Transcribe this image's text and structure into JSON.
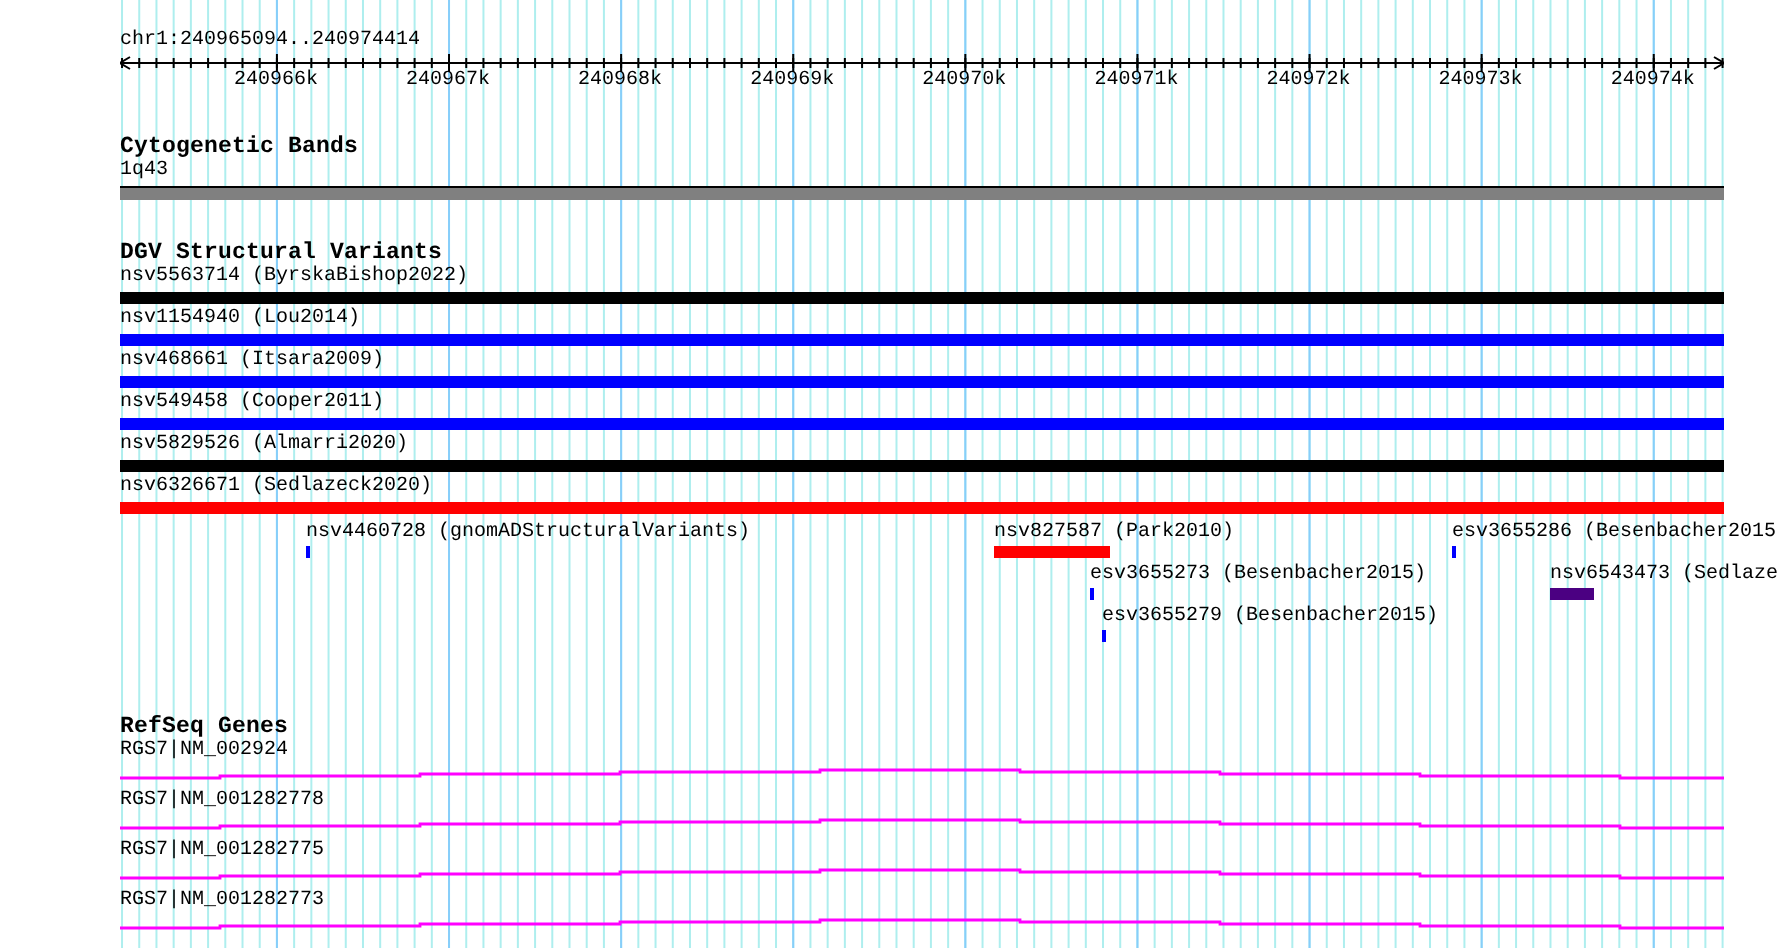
{
  "location": "chr1:240965094..240974414",
  "ruler": {
    "ticks": [
      "240966k",
      "240967k",
      "240968k",
      "240969k",
      "240970k",
      "240971k",
      "240972k",
      "240973k",
      "240974k"
    ]
  },
  "cytogenetic_bands": {
    "title": "Cytogenetic Bands",
    "bands": [
      {
        "label": "1q43"
      }
    ]
  },
  "dgv_structural_variants": {
    "title": "DGV Structural Variants",
    "variants": [
      {
        "label": "nsv5563714 (ByrskaBishop2022)",
        "color": "#000000"
      },
      {
        "label": "nsv1154940 (Lou2014)",
        "color": "#0000ff"
      },
      {
        "label": "nsv468661 (Itsara2009)",
        "color": "#0000ff"
      },
      {
        "label": "nsv549458 (Cooper2011)",
        "color": "#0000ff"
      },
      {
        "label": "nsv5829526 (Almarri2020)",
        "color": "#000000"
      },
      {
        "label": "nsv6326671 (Sedlazeck2020)",
        "color": "#ff0000"
      },
      {
        "label": "nsv4460728 (gnomADStructuralVariants)",
        "color": "#0000ff"
      },
      {
        "label": "nsv827587 (Park2010)",
        "color": "#ff0000"
      },
      {
        "label": "esv3655286 (Besenbacher2015",
        "color": "#0000ff"
      },
      {
        "label": "esv3655273 (Besenbacher2015)",
        "color": "#0000ff"
      },
      {
        "label": "nsv6543473 (Sedlaze",
        "color": "#4b0082"
      },
      {
        "label": "esv3655279 (Besenbacher2015)",
        "color": "#0000ff"
      }
    ]
  },
  "refseq_genes": {
    "title": "RefSeq Genes",
    "transcripts": [
      {
        "label": "RGS7|NM_002924"
      },
      {
        "label": "RGS7|NM_001282778"
      },
      {
        "label": "RGS7|NM_001282775"
      },
      {
        "label": "RGS7|NM_001282773"
      }
    ]
  }
}
